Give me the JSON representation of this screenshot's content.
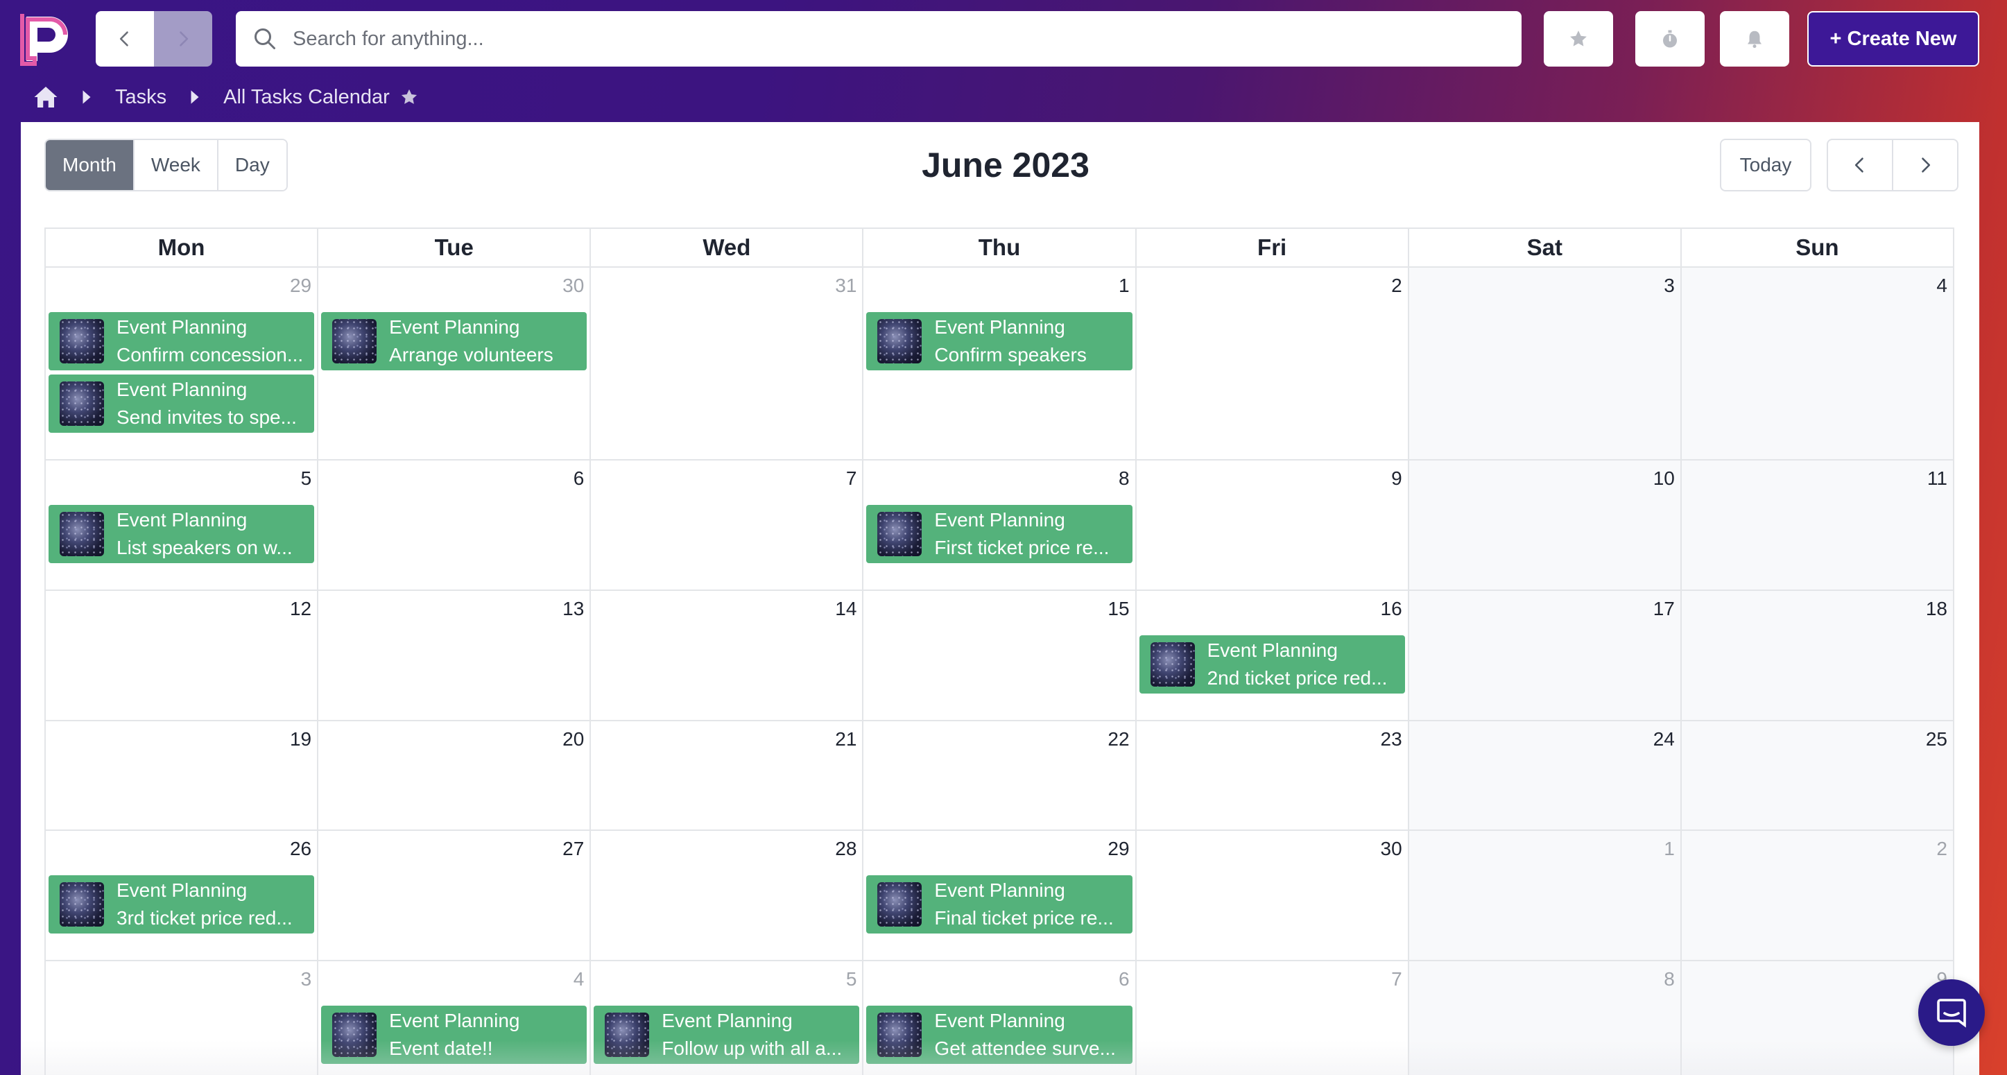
{
  "search": {
    "placeholder": "Search for anything..."
  },
  "toolbar": {
    "create_label": "+ Create New"
  },
  "icons": {
    "logo": "app-logo",
    "back": "chevron-left-icon",
    "forward": "chevron-right-icon",
    "search": "search-icon",
    "favorites": "star-icon",
    "timer": "stopwatch-icon",
    "notifications": "bell-icon",
    "chat": "chat-icon"
  },
  "colors": {
    "brand": "#3d1897",
    "event": "#54b27b",
    "active_view": "#6b7280"
  },
  "breadcrumb": {
    "tasks": "Tasks",
    "current": "All Tasks Calendar"
  },
  "calendar": {
    "views": [
      "Month",
      "Week",
      "Day"
    ],
    "active_view": "Month",
    "title": "June 2023",
    "today_label": "Today",
    "weekdays": [
      "Mon",
      "Tue",
      "Wed",
      "Thu",
      "Fri",
      "Sat",
      "Sun"
    ],
    "weeks": [
      [
        {
          "n": "29",
          "muted": true,
          "events": [
            {
              "project": "Event Planning",
              "task": "Confirm concession..."
            },
            {
              "project": "Event Planning",
              "task": "Send invites to spe..."
            }
          ]
        },
        {
          "n": "30",
          "muted": true,
          "events": [
            {
              "project": "Event Planning",
              "task": "Arrange volunteers"
            }
          ]
        },
        {
          "n": "31",
          "muted": true,
          "events": []
        },
        {
          "n": "1",
          "muted": false,
          "events": [
            {
              "project": "Event Planning",
              "task": "Confirm speakers"
            }
          ]
        },
        {
          "n": "2",
          "muted": false,
          "events": []
        },
        {
          "n": "3",
          "muted": false,
          "events": []
        },
        {
          "n": "4",
          "muted": false,
          "events": []
        }
      ],
      [
        {
          "n": "5",
          "muted": false,
          "events": [
            {
              "project": "Event Planning",
              "task": "List speakers on w..."
            }
          ]
        },
        {
          "n": "6",
          "muted": false,
          "events": []
        },
        {
          "n": "7",
          "muted": false,
          "events": []
        },
        {
          "n": "8",
          "muted": false,
          "events": [
            {
              "project": "Event Planning",
              "task": "First ticket price re..."
            }
          ]
        },
        {
          "n": "9",
          "muted": false,
          "events": []
        },
        {
          "n": "10",
          "muted": false,
          "events": []
        },
        {
          "n": "11",
          "muted": false,
          "events": []
        }
      ],
      [
        {
          "n": "12",
          "muted": false,
          "events": []
        },
        {
          "n": "13",
          "muted": false,
          "events": []
        },
        {
          "n": "14",
          "muted": false,
          "events": []
        },
        {
          "n": "15",
          "muted": false,
          "events": []
        },
        {
          "n": "16",
          "muted": false,
          "events": [
            {
              "project": "Event Planning",
              "task": "2nd ticket price red..."
            }
          ]
        },
        {
          "n": "17",
          "muted": false,
          "events": []
        },
        {
          "n": "18",
          "muted": false,
          "events": []
        }
      ],
      [
        {
          "n": "19",
          "muted": false,
          "events": []
        },
        {
          "n": "20",
          "muted": false,
          "events": []
        },
        {
          "n": "21",
          "muted": false,
          "events": []
        },
        {
          "n": "22",
          "muted": false,
          "events": []
        },
        {
          "n": "23",
          "muted": false,
          "events": []
        },
        {
          "n": "24",
          "muted": false,
          "events": []
        },
        {
          "n": "25",
          "muted": false,
          "events": []
        }
      ],
      [
        {
          "n": "26",
          "muted": false,
          "events": [
            {
              "project": "Event Planning",
              "task": "3rd ticket price red..."
            }
          ]
        },
        {
          "n": "27",
          "muted": false,
          "events": []
        },
        {
          "n": "28",
          "muted": false,
          "events": []
        },
        {
          "n": "29",
          "muted": false,
          "events": [
            {
              "project": "Event Planning",
              "task": "Final ticket price re..."
            }
          ]
        },
        {
          "n": "30",
          "muted": false,
          "events": []
        },
        {
          "n": "1",
          "muted": true,
          "events": []
        },
        {
          "n": "2",
          "muted": true,
          "events": []
        }
      ],
      [
        {
          "n": "3",
          "muted": true,
          "events": []
        },
        {
          "n": "4",
          "muted": true,
          "events": [
            {
              "project": "Event Planning",
              "task": "Event date!!"
            }
          ]
        },
        {
          "n": "5",
          "muted": true,
          "events": [
            {
              "project": "Event Planning",
              "task": "Follow up with all a..."
            }
          ]
        },
        {
          "n": "6",
          "muted": true,
          "events": [
            {
              "project": "Event Planning",
              "task": "Get attendee surve..."
            }
          ]
        },
        {
          "n": "7",
          "muted": true,
          "events": []
        },
        {
          "n": "8",
          "muted": true,
          "events": []
        },
        {
          "n": "9",
          "muted": true,
          "events": []
        }
      ]
    ]
  }
}
